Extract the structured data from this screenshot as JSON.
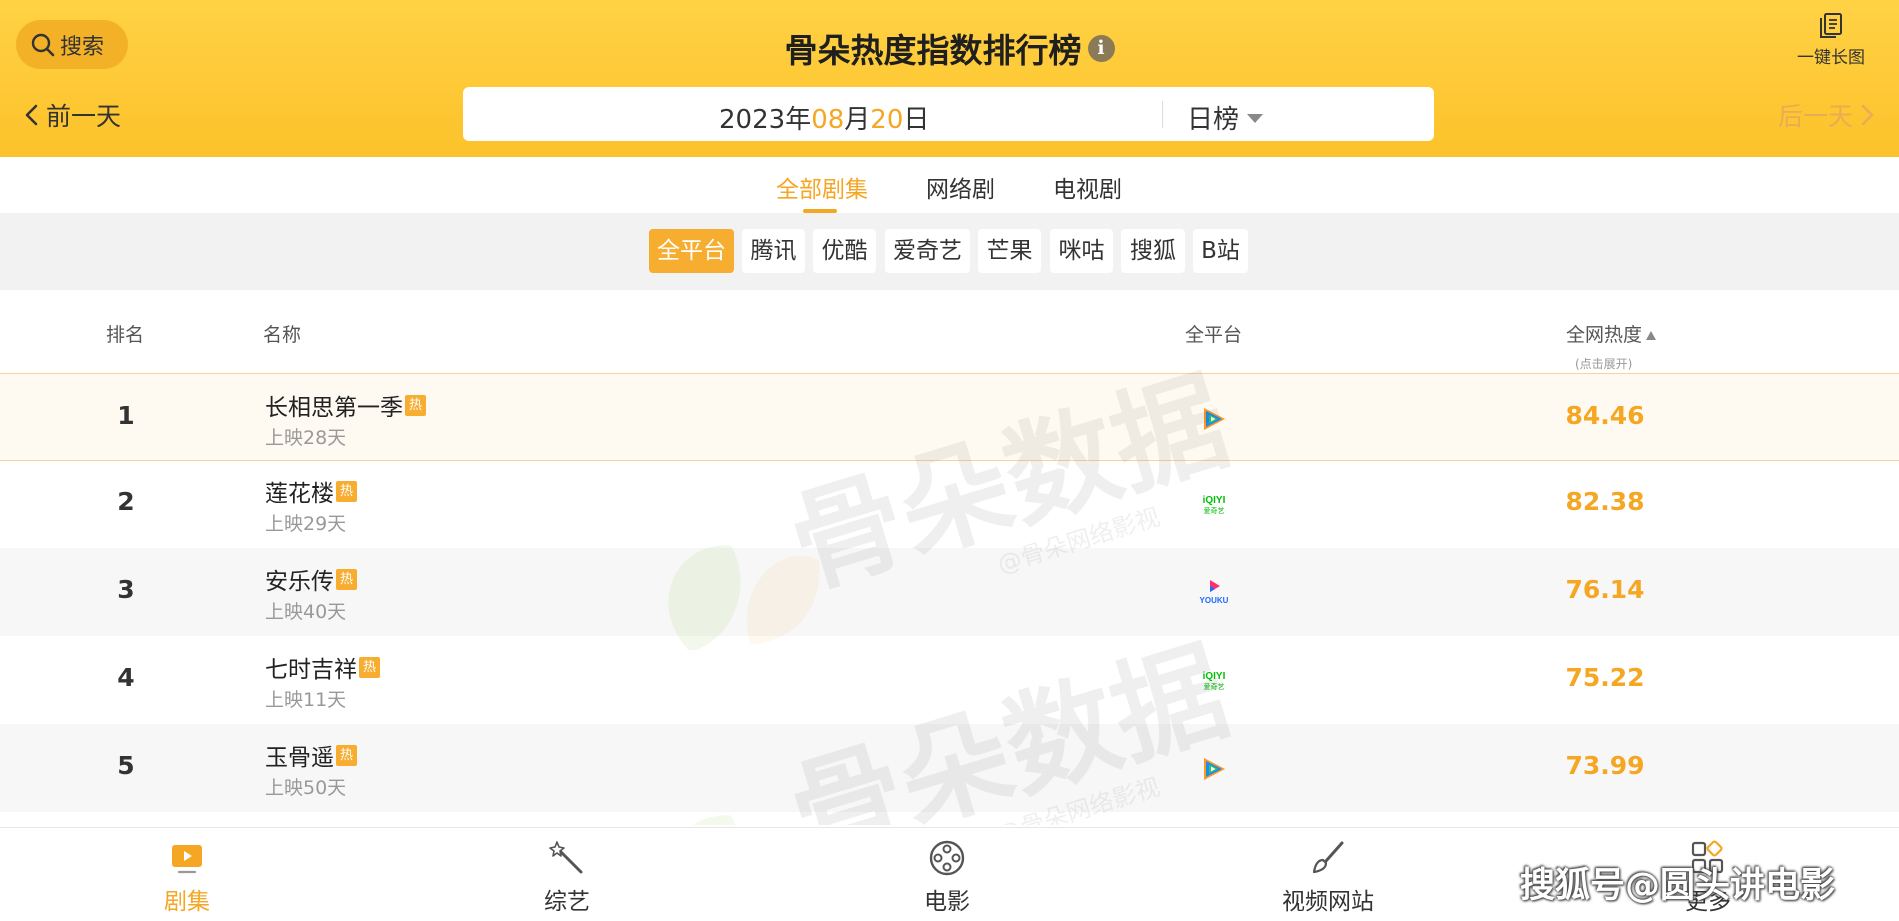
{
  "header": {
    "search_label": "搜索",
    "title": "骨朵热度指数排行榜",
    "info_symbol": "i",
    "long_image_label": "一键长图",
    "prev_day_label": "前一天",
    "next_day_label": "后一天",
    "date": {
      "year": "2023",
      "year_unit": "年",
      "month": "08",
      "month_unit": "月",
      "day": "20",
      "day_unit": "日"
    },
    "rank_type": "日榜"
  },
  "category_tabs": [
    {
      "label": "全部剧集",
      "active": true
    },
    {
      "label": "网络剧",
      "active": false
    },
    {
      "label": "电视剧",
      "active": false
    }
  ],
  "platform_filters": [
    {
      "label": "全平台",
      "active": true
    },
    {
      "label": "腾讯",
      "active": false
    },
    {
      "label": "优酷",
      "active": false
    },
    {
      "label": "爱奇艺",
      "active": false
    },
    {
      "label": "芒果",
      "active": false
    },
    {
      "label": "咪咕",
      "active": false
    },
    {
      "label": "搜狐",
      "active": false
    },
    {
      "label": "B站",
      "active": false
    }
  ],
  "table": {
    "headers": {
      "rank": "排名",
      "name": "名称",
      "platform": "全平台",
      "heat": "全网热度",
      "heat_note": "(点击展开)"
    },
    "hot_badge": "热",
    "rows": [
      {
        "rank": "1",
        "name": "长相思第一季",
        "days": "上映28天",
        "platform": "tencent-video-icon",
        "heat": "84.46"
      },
      {
        "rank": "2",
        "name": "莲花楼",
        "days": "上映29天",
        "platform": "iqiyi-icon",
        "heat": "82.38"
      },
      {
        "rank": "3",
        "name": "安乐传",
        "days": "上映40天",
        "platform": "youku-icon",
        "heat": "76.14"
      },
      {
        "rank": "4",
        "name": "七时吉祥",
        "days": "上映11天",
        "platform": "iqiyi-icon",
        "heat": "75.22"
      },
      {
        "rank": "5",
        "name": "玉骨遥",
        "days": "上映50天",
        "platform": "tencent-video-icon",
        "heat": "73.99"
      }
    ]
  },
  "platform_logo_text": {
    "iqiyi_top": "iQIYI",
    "iqiyi_bottom": "爱奇艺",
    "youku": "YOUKU"
  },
  "watermark": {
    "main": "骨朵数据",
    "sub": "@骨朵网络影视"
  },
  "bottom_nav": [
    {
      "label": "剧集",
      "icon": "tv-icon",
      "active": true
    },
    {
      "label": "综艺",
      "icon": "magic-wand-icon",
      "active": false
    },
    {
      "label": "电影",
      "icon": "film-reel-icon",
      "active": false
    },
    {
      "label": "视频网站",
      "icon": "brush-icon",
      "active": false
    },
    {
      "label": "更多",
      "icon": "apps-icon",
      "active": false
    }
  ],
  "source_watermark": "搜狐号@圆头讲电影",
  "colors": {
    "accent": "#f5a623",
    "header": "#fcc22a",
    "iqiyi": "#00be06",
    "tencent_green": "#29c95b",
    "tencent_blue": "#1c8cf2",
    "tencent_orange": "#ff9a1e",
    "youku_pink": "#ff2f6e",
    "youku_blue": "#1d6cfa"
  }
}
